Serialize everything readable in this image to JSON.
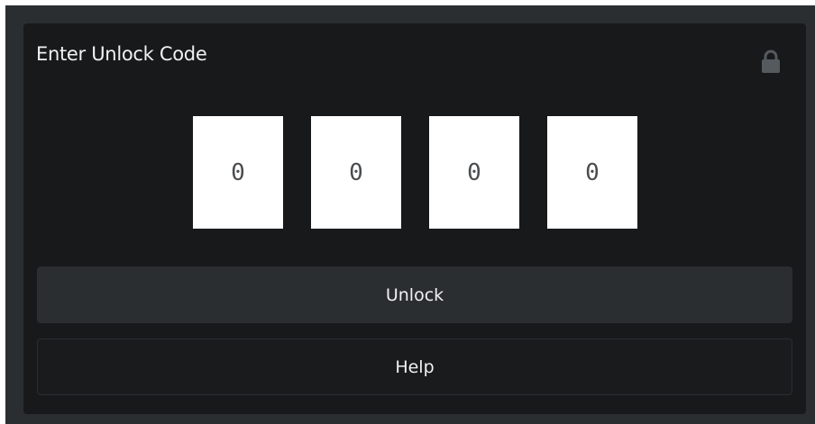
{
  "dialog": {
    "title": "Enter Unlock Code",
    "icon": "lock-icon"
  },
  "code": {
    "digits": [
      "0",
      "0",
      "0",
      "0"
    ]
  },
  "actions": {
    "unlock_label": "Unlock",
    "help_label": "Help"
  },
  "colors": {
    "outer_background": "#2b2e31",
    "panel_background": "#18191b",
    "digit_background": "#ffffff",
    "digit_text": "#4a4d50",
    "unlock_button": "#2a2e31",
    "help_button": "#1a1b1d",
    "text": "#f1f1f1"
  }
}
